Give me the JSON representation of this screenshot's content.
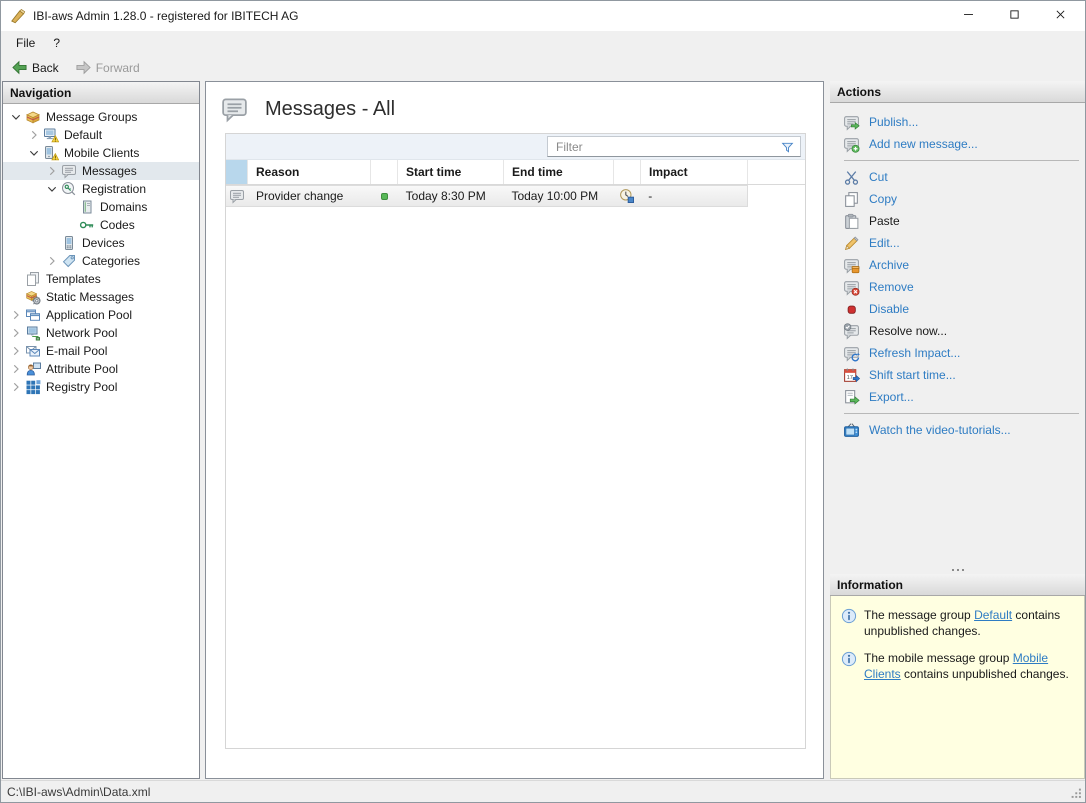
{
  "window": {
    "title": "IBI-aws Admin 1.28.0 - registered for IBITECH AG",
    "controls": {
      "minimize": "minimize",
      "maximize": "maximize",
      "close": "close"
    }
  },
  "menu": {
    "items": [
      {
        "label": "File"
      },
      {
        "label": "?"
      }
    ]
  },
  "toolbar": {
    "back_label": "Back",
    "forward_label": "Forward"
  },
  "navigation": {
    "header": "Navigation",
    "items": [
      {
        "label": "Message Groups",
        "icon": "message-groups-icon",
        "level": 0,
        "expander": "expanded",
        "selected": false
      },
      {
        "label": "Default",
        "icon": "default-group-icon",
        "level": 1,
        "expander": "collapsed",
        "selected": false
      },
      {
        "label": "Mobile Clients",
        "icon": "mobile-clients-icon",
        "level": 1,
        "expander": "expanded",
        "selected": false
      },
      {
        "label": "Messages",
        "icon": "messages-icon",
        "level": 2,
        "expander": "collapsed",
        "selected": true
      },
      {
        "label": "Registration",
        "icon": "registration-icon",
        "level": 2,
        "expander": "expanded",
        "selected": false
      },
      {
        "label": "Domains",
        "icon": "domains-icon",
        "level": 3,
        "expander": "none",
        "selected": false
      },
      {
        "label": "Codes",
        "icon": "codes-icon",
        "level": 3,
        "expander": "none",
        "selected": false
      },
      {
        "label": "Devices",
        "icon": "devices-icon",
        "level": 2,
        "expander": "none",
        "selected": false
      },
      {
        "label": "Categories",
        "icon": "categories-icon",
        "level": 2,
        "expander": "collapsed",
        "selected": false
      },
      {
        "label": "Templates",
        "icon": "templates-icon",
        "level": 0,
        "expander": "none",
        "selected": false
      },
      {
        "label": "Static Messages",
        "icon": "static-messages-icon",
        "level": 0,
        "expander": "none",
        "selected": false
      },
      {
        "label": "Application Pool",
        "icon": "application-pool-icon",
        "level": 0,
        "expander": "collapsed",
        "selected": false
      },
      {
        "label": "Network Pool",
        "icon": "network-pool-icon",
        "level": 0,
        "expander": "collapsed",
        "selected": false
      },
      {
        "label": "E-mail Pool",
        "icon": "email-pool-icon",
        "level": 0,
        "expander": "collapsed",
        "selected": false
      },
      {
        "label": "Attribute Pool",
        "icon": "attribute-pool-icon",
        "level": 0,
        "expander": "collapsed",
        "selected": false
      },
      {
        "label": "Registry Pool",
        "icon": "registry-pool-icon",
        "level": 0,
        "expander": "collapsed",
        "selected": false
      }
    ]
  },
  "main": {
    "title": "Messages - All",
    "title_icon": "messages-icon",
    "filter_placeholder": "Filter",
    "table": {
      "columns": [
        "Reason",
        "Start time",
        "End time",
        "Impact"
      ],
      "rows": [
        {
          "icon": "messages-icon",
          "reason": "Provider change",
          "status": "active",
          "start_time": "Today 8:30 PM",
          "end_time": "Today 10:00 PM",
          "impact_icon": "impact-clock-icon",
          "impact": "-"
        }
      ]
    }
  },
  "actions": {
    "header": "Actions",
    "items": [
      {
        "label": "Publish...",
        "icon": "publish-icon",
        "enabled": true,
        "group": 1
      },
      {
        "label": "Add new message...",
        "icon": "add-message-icon",
        "enabled": true,
        "group": 1
      },
      {
        "label": "Cut",
        "icon": "cut-icon",
        "enabled": true,
        "group": 2
      },
      {
        "label": "Copy",
        "icon": "copy-icon",
        "enabled": true,
        "group": 2
      },
      {
        "label": "Paste",
        "icon": "paste-icon",
        "enabled": false,
        "group": 2
      },
      {
        "label": "Edit...",
        "icon": "edit-icon",
        "enabled": true,
        "group": 2
      },
      {
        "label": "Archive",
        "icon": "archive-icon",
        "enabled": true,
        "group": 2
      },
      {
        "label": "Remove",
        "icon": "remove-icon",
        "enabled": true,
        "group": 2
      },
      {
        "label": "Disable",
        "icon": "disable-icon",
        "enabled": true,
        "group": 2
      },
      {
        "label": "Resolve now...",
        "icon": "resolve-icon",
        "enabled": false,
        "group": 2
      },
      {
        "label": "Refresh Impact...",
        "icon": "refresh-impact-icon",
        "enabled": true,
        "group": 2
      },
      {
        "label": "Shift start time...",
        "icon": "shift-start-time-icon",
        "enabled": true,
        "group": 2
      },
      {
        "label": "Export...",
        "icon": "export-icon",
        "enabled": true,
        "group": 2
      },
      {
        "label": "Watch the video-tutorials...",
        "icon": "video-tutorials-icon",
        "enabled": true,
        "group": 3
      }
    ]
  },
  "information": {
    "header": "Information",
    "items": [
      {
        "text_before": "The message group ",
        "link": "Default",
        "text_after": " contains unpublished changes."
      },
      {
        "text_before": "The mobile message group ",
        "link": "Mobile Clients",
        "text_after": " contains unpublished changes."
      }
    ]
  },
  "statusbar": {
    "path": "C:\\IBI-aws\\Admin\\Data.xml"
  },
  "colors": {
    "link_blue": "#2e7cc3",
    "status_green": "#58b858",
    "info_bg": "#ffffe1",
    "selection_blue": "#b8d7ec",
    "nav_selected": "#e2e8ed"
  }
}
